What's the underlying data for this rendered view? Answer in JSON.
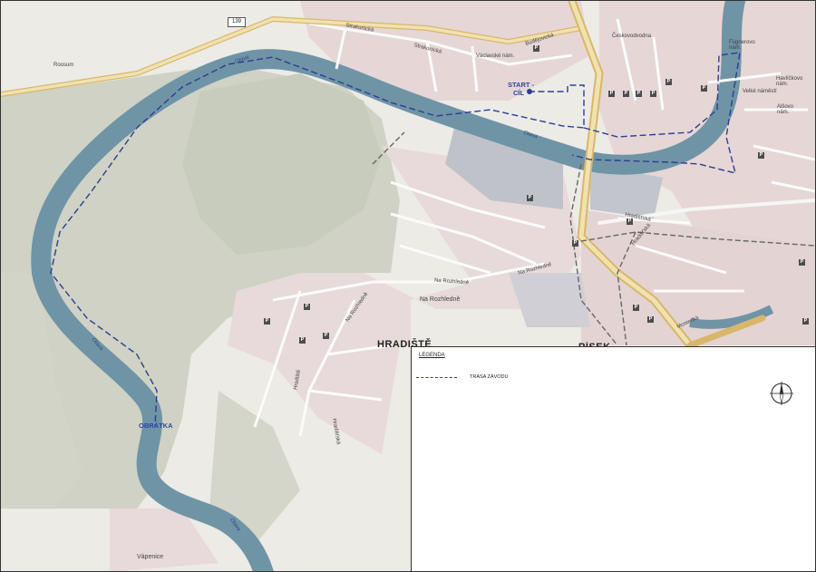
{
  "map": {
    "road_number": "139",
    "labels": {
      "rooseum": "Roosum",
      "strakonicka_1": "Strakonická",
      "strakonicka_2": "Strakonická",
      "budejovicka": "Budějovická",
      "vaclavske": "Václavské nám.",
      "ceskovodvana": "Českovodvodna",
      "fugnerovo": "Fügnerovo nám.",
      "havlickovo": "Havlíčkovo nám.",
      "velke_namesti": "Velké náměstí",
      "alsovo": "Alšovo nám.",
      "otava_1": "Otava",
      "otava_2": "Otava",
      "otava_3": "Otava",
      "otava_4": "Otava",
      "hradistska": "Hradišťská",
      "mostecka": "Mostecká",
      "na_rozhledne_1": "Na Rozhledně",
      "na_rozhledne_2": "Na Rozhledně",
      "na_rozhledne_3": "Na Rozhledně",
      "na_rozhledne_4": "Na Rozhledně",
      "hradiste": "HRADIŠTĚ",
      "pisek": "PÍSEK",
      "hradiste_street": "Hradiště",
      "vapenice": "Vápenice",
      "hradistska_2": "Hradišťská"
    },
    "start_label": "START -",
    "cil_label": "CÍL",
    "obratka_label": "OBRÁTKA",
    "parking_symbol": "P"
  },
  "legend": {
    "title": "LEGENDA",
    "item_label": "TRASA  ZÁVODU"
  },
  "colors": {
    "river": "#6f94a6",
    "route": "#2c3e93",
    "background": "#ecebe6",
    "forest": "#cdd0c1",
    "urban": "#e7d8d8",
    "road_major": "#e6c77a"
  }
}
